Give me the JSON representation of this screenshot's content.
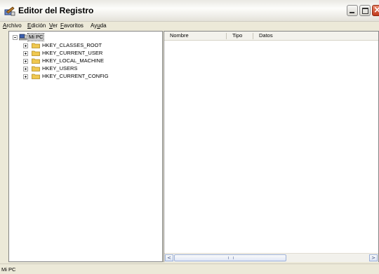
{
  "window": {
    "title": "Editor del Registro"
  },
  "menu": [
    {
      "pre": "",
      "key": "A",
      "post": "rchivo"
    },
    {
      "pre": "",
      "key": "E",
      "post": "dición"
    },
    {
      "pre": "",
      "key": "V",
      "post": "er"
    },
    {
      "pre": "",
      "key": "F",
      "post": "avoritos"
    },
    {
      "pre": "Ay",
      "key": "u",
      "post": "da"
    }
  ],
  "tree": {
    "root": {
      "label": "Mi PC",
      "expanded": true,
      "selected": true
    },
    "children": [
      {
        "label": "HKEY_CLASSES_ROOT"
      },
      {
        "label": "HKEY_CURRENT_USER"
      },
      {
        "label": "HKEY_LOCAL_MACHINE"
      },
      {
        "label": "HKEY_USERS"
      },
      {
        "label": "HKEY_CURRENT_CONFIG"
      }
    ]
  },
  "list": {
    "columns": [
      "Nombre",
      "Tipo",
      "Datos"
    ],
    "rows": []
  },
  "scrollbar": {
    "left_arrow": "<",
    "right_arrow": ">"
  },
  "status": {
    "text": "Mi PC"
  },
  "colors": {
    "folder": "#f0c850",
    "selection": "#c8c8c8",
    "close_button": "#c0391b"
  }
}
